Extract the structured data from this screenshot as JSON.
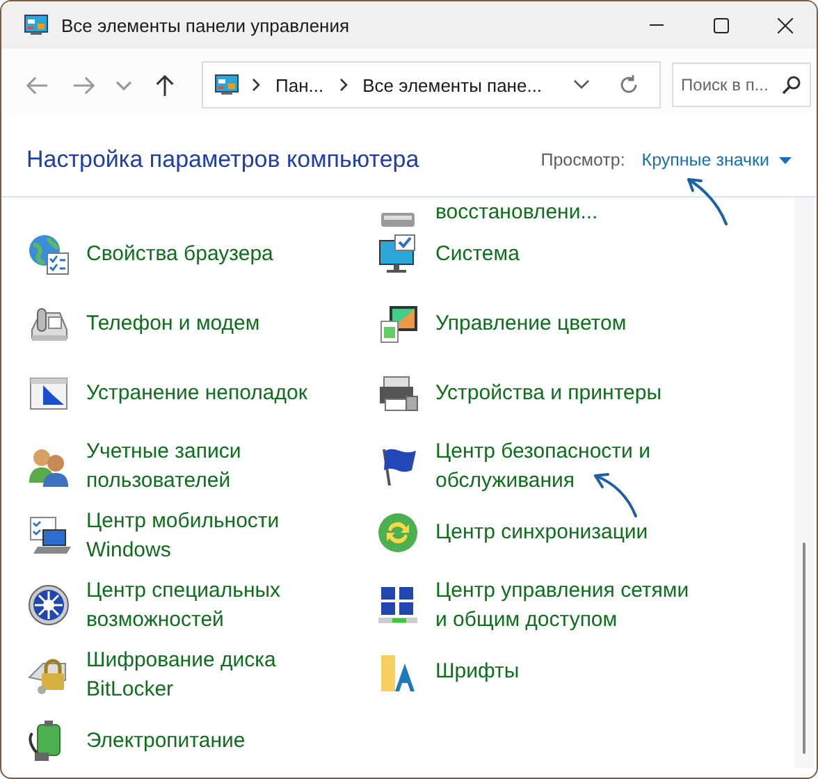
{
  "window": {
    "title": "Все элементы панели управления"
  },
  "nav_buttons": [
    {
      "kind": "back",
      "disabled": true
    },
    {
      "kind": "forward",
      "disabled": true
    },
    {
      "kind": "recent",
      "disabled": true
    },
    {
      "kind": "up",
      "disabled": false
    }
  ],
  "address_bar": {
    "crumbs": [
      "Пан...",
      "Все элементы пане..."
    ]
  },
  "search": {
    "placeholder": "Поиск в п..."
  },
  "header": {
    "title": "Настройка параметров компьютера",
    "view_label": "Просмотр:",
    "view_value": "Крупные значки"
  },
  "items": [
    {
      "label": "восстановлени..."
    },
    {
      "label": "Свойства браузера"
    },
    {
      "label": "Система"
    },
    {
      "label": "Телефон и модем"
    },
    {
      "label": "Управление цветом"
    },
    {
      "label": "Устранение неполадок"
    },
    {
      "label": "Устройства и принтеры"
    },
    {
      "label": "Учетные записи пользователей"
    },
    {
      "label": "Центр безопасности и обслуживания"
    },
    {
      "label": "Центр мобильности Windows"
    },
    {
      "label": "Центр синхронизации"
    },
    {
      "label": "Центр специальных возможностей"
    },
    {
      "label": "Центр управления сетями и общим доступом"
    },
    {
      "label": "Шифрование диска BitLocker"
    },
    {
      "label": "Шрифты"
    },
    {
      "label": "Электропитание"
    }
  ]
}
